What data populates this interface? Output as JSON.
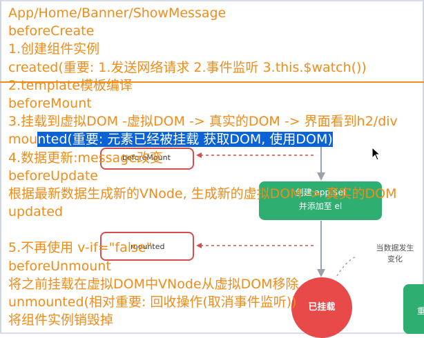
{
  "lines": [
    "App/Home/Banner/ShowMessage",
    "beforeCreate",
    "1.创建组件实例",
    "created(重要: 1.发送网络请求 2.事件监听 3.this.$watch())",
    "2.template模板编译",
    "beforeMount",
    "3.挂载到虚拟DOM -虚拟DOM -> 真实的DOM -> 界面看到h2/div",
    "4.数据更新:message改变",
    "beforeUpdate",
    "根据最新数据生成新的VNode, 生成新的虚拟DOM -> 真实的DOM",
    "updated",
    "",
    "5.不再使用 v-if=\"false\"",
    "beforeUnmount",
    "将之前挂载在虚拟DOM中VNode从虚拟DOM移除",
    "unmounted(相对重要: 回收操作(取消事件监听))",
    "将组件实例销毁掉"
  ],
  "mounted_line": {
    "plain": "mou",
    "highlighted": "nted(重要: 元素已经被挂载 获取DOM, 使用DOM)"
  },
  "diagram": {
    "hook_before_mount": "beforeMount",
    "hook_mounted": "mounted",
    "create_el_line1": "创建 app.$el",
    "create_el_line2": "并添加至 el",
    "mounted_state": "已挂载",
    "data_change_line1": "当数据发生",
    "data_change_line2": "变化",
    "right_box_text": "重"
  },
  "colors": {
    "overlay_text": "#f08c1a",
    "selection": "#0a63d6",
    "hook_border": "#d94b4b",
    "green_node": "#2fae72",
    "red_node": "#e84a4a"
  },
  "icons": {
    "cursor": "mouse-pointer-icon"
  }
}
